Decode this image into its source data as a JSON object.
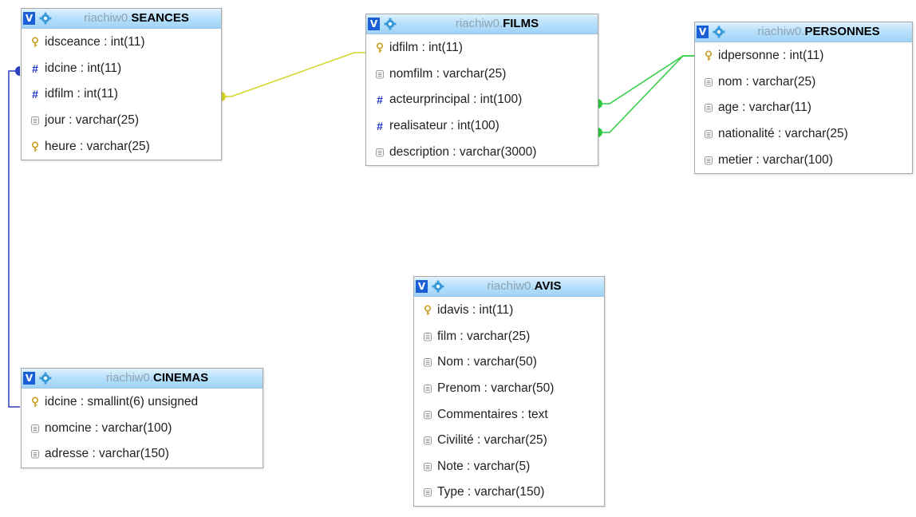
{
  "tables": {
    "seances": {
      "db": "riachiw0.",
      "name": "SEANCES",
      "columns": [
        {
          "label": "idsceance : int(11)",
          "icon": "key-icon"
        },
        {
          "label": "idcine : int(11)",
          "icon": "index-hash-icon"
        },
        {
          "label": "idfilm : int(11)",
          "icon": "index-hash-icon"
        },
        {
          "label": "jour : varchar(25)",
          "icon": "column-icon"
        },
        {
          "label": "heure : varchar(25)",
          "icon": "key-icon"
        }
      ]
    },
    "films": {
      "db": "riachiw0.",
      "name": "FILMS",
      "columns": [
        {
          "label": "idfilm : int(11)",
          "icon": "key-icon"
        },
        {
          "label": "nomfilm : varchar(25)",
          "icon": "column-icon"
        },
        {
          "label": "acteurprincipal : int(100)",
          "icon": "index-hash-icon"
        },
        {
          "label": "realisateur : int(100)",
          "icon": "index-hash-icon"
        },
        {
          "label": "description : varchar(3000)",
          "icon": "column-icon"
        }
      ]
    },
    "personnes": {
      "db": "riachiw0.",
      "name": "PERSONNES",
      "columns": [
        {
          "label": "idpersonne : int(11)",
          "icon": "key-icon"
        },
        {
          "label": "nom : varchar(25)",
          "icon": "column-icon"
        },
        {
          "label": "age : varchar(11)",
          "icon": "column-icon"
        },
        {
          "label": "nationalité : varchar(25)",
          "icon": "column-icon"
        },
        {
          "label": "metier : varchar(100)",
          "icon": "column-icon"
        }
      ]
    },
    "avis": {
      "db": "riachiw0.",
      "name": "AVIS",
      "columns": [
        {
          "label": "idavis : int(11)",
          "icon": "key-icon"
        },
        {
          "label": "film : varchar(25)",
          "icon": "column-icon"
        },
        {
          "label": "Nom : varchar(50)",
          "icon": "column-icon"
        },
        {
          "label": "Prenom : varchar(50)",
          "icon": "column-icon"
        },
        {
          "label": "Commentaires : text",
          "icon": "column-icon"
        },
        {
          "label": "Civilité : varchar(25)",
          "icon": "column-icon"
        },
        {
          "label": "Note : varchar(5)",
          "icon": "column-icon"
        },
        {
          "label": "Type : varchar(150)",
          "icon": "column-icon"
        }
      ]
    },
    "cinemas": {
      "db": "riachiw0.",
      "name": "CINEMAS",
      "columns": [
        {
          "label": "idcine : smallint(6) unsigned",
          "icon": "key-icon"
        },
        {
          "label": "nomcine : varchar(100)",
          "icon": "column-icon"
        },
        {
          "label": "adresse : varchar(150)",
          "icon": "column-icon"
        }
      ]
    }
  },
  "header": {
    "toggle_label": "V",
    "options_icon": "gear-icon"
  },
  "colors": {
    "relation_films_seances": "#d4d42a",
    "relation_personnes_films": "#2ecc40",
    "relation_cinemas_seances": "#2c3fbf",
    "header_toggle": "#1b5fd6",
    "gear": "#3a9ad9",
    "key": "#c9a227",
    "hash": "#1e33c8"
  }
}
